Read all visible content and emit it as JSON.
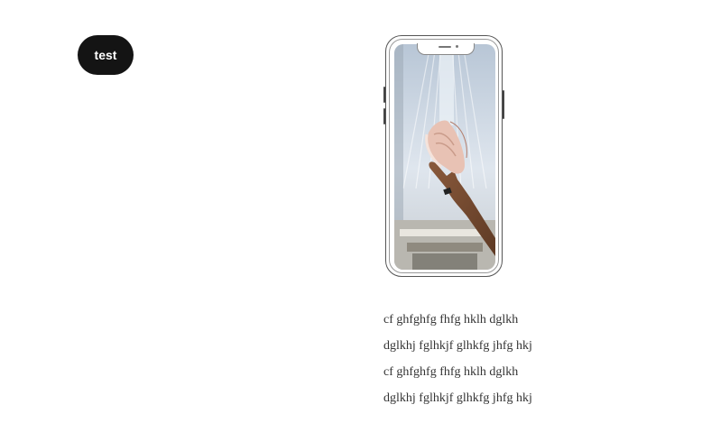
{
  "button": {
    "label": "test"
  },
  "phone": {
    "screen_image": "photo-of-hand-holding-pink-sneaker",
    "colors": {
      "sneaker": "#e8c2b4",
      "sky": "#c9d6e2"
    }
  },
  "caption_lines": [
    " cf ghfghfg fhfg hklh  dglkh",
    "dglkhj fglhkjf glhkfg jhfg hkj",
    "cf ghfghfg fhfg hklh  dglkh",
    "dglkhj fglhkjf glhkfg jhfg hkj"
  ]
}
